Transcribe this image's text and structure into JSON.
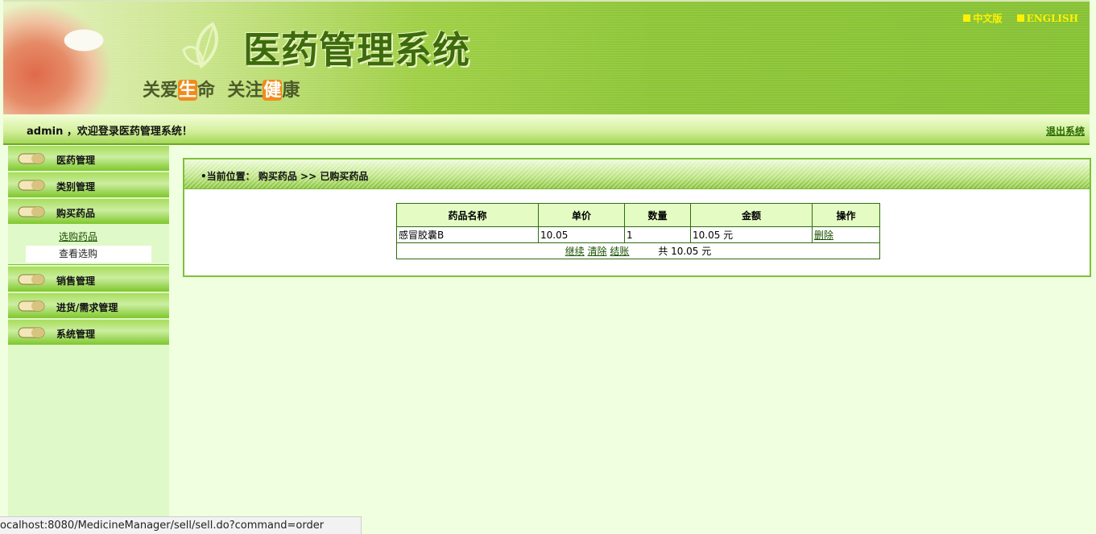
{
  "banner": {
    "title": "医药管理系统",
    "slogan_a": "关爱",
    "slogan_a_hl": "生",
    "slogan_a_end": "命",
    "slogan_b": "关注",
    "slogan_b_hl": "健",
    "slogan_b_end": "康",
    "lang_cn": "中文版",
    "lang_en": "ENGLISH"
  },
  "welcome": {
    "text": "admin ，欢迎登录医药管理系统！",
    "logout": "退出系统"
  },
  "sidebar": {
    "items": [
      {
        "label": "医药管理"
      },
      {
        "label": "类别管理"
      },
      {
        "label": "购买药品"
      },
      {
        "label": "销售管理"
      },
      {
        "label": "进货/需求管理"
      },
      {
        "label": "系统管理"
      }
    ],
    "submenu": [
      {
        "label": "选购药品"
      },
      {
        "label": "查看选购"
      }
    ]
  },
  "content": {
    "breadcrumb": "•当前位置： 购买药品 >> 已购买药品",
    "table": {
      "headers": [
        "药品名称",
        "单价",
        "数量",
        "金额",
        "操作"
      ],
      "rows": [
        {
          "name": "感冒胶囊B",
          "price": "10.05",
          "qty": "1",
          "amount": "10.05 元",
          "action": "删除"
        }
      ],
      "footer": {
        "continue": "继续",
        "clear": "清除",
        "checkout": "结账",
        "total": "共 10.05  元"
      }
    }
  },
  "status_url": "ocalhost:8080/MedicineManager/sell/sell.do?command=order",
  "colors": {
    "accent_green": "#7fbf3a",
    "background": "#f0ffe0",
    "lang_yellow": "#fff200",
    "slogan_orange": "#f08c1c"
  }
}
